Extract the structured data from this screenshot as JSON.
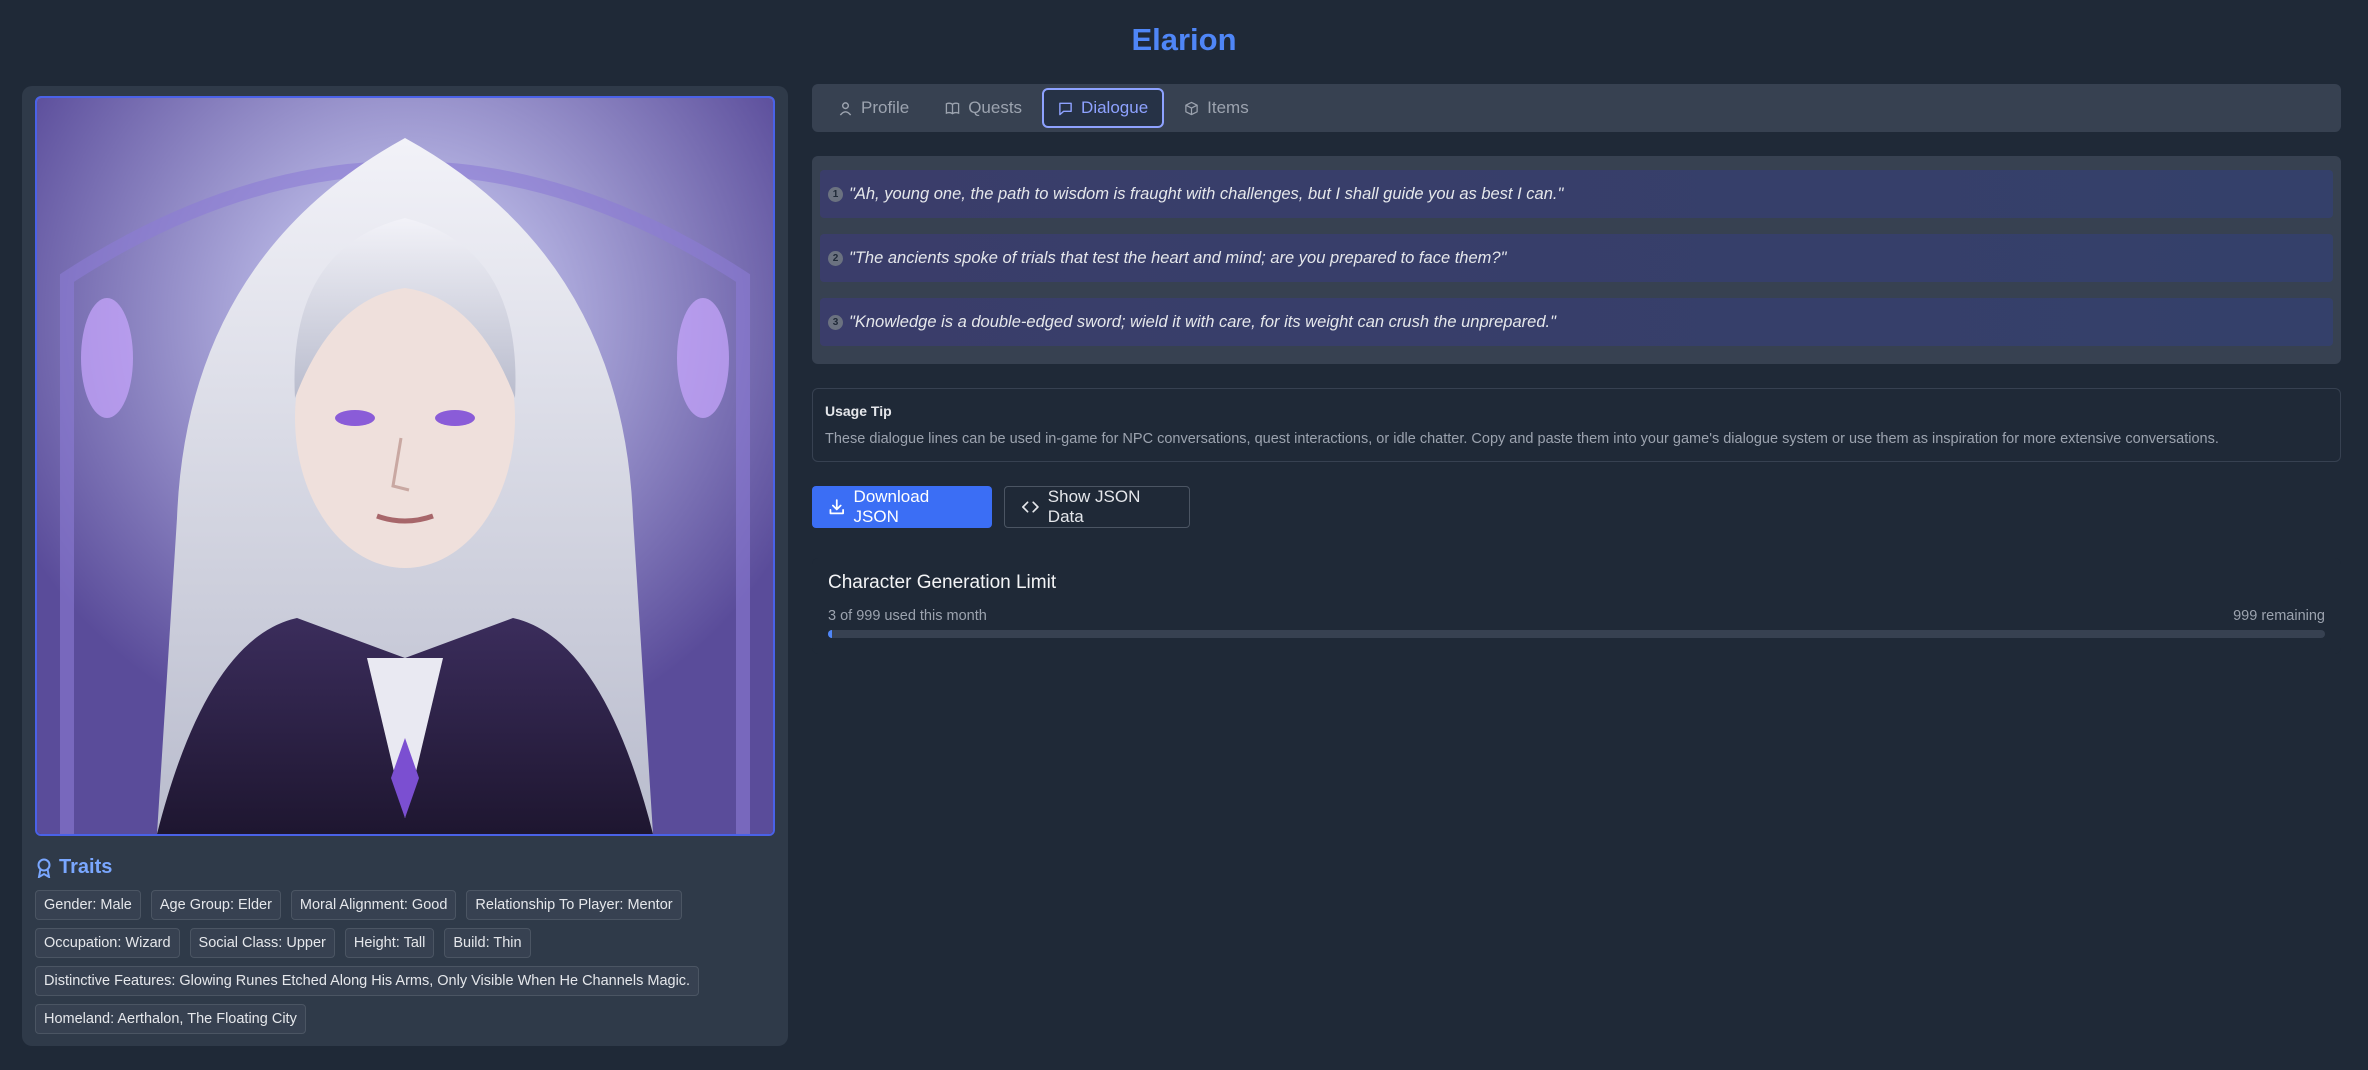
{
  "page": {
    "title": "Elarion"
  },
  "tabs": [
    {
      "label": "Profile",
      "icon": "user-icon"
    },
    {
      "label": "Quests",
      "icon": "book-icon"
    },
    {
      "label": "Dialogue",
      "icon": "message-icon",
      "active": true
    },
    {
      "label": "Items",
      "icon": "cube-icon"
    }
  ],
  "dialogue": [
    {
      "n": "1",
      "text": "\"Ah, young one, the path to wisdom is fraught with challenges, but I shall guide you as best I can.\""
    },
    {
      "n": "2",
      "text": "\"The ancients spoke of trials that test the heart and mind; are you prepared to face them?\""
    },
    {
      "n": "3",
      "text": "\"Knowledge is a double-edged sword; wield it with care, for its weight can crush the unprepared.\""
    }
  ],
  "tip": {
    "title": "Usage Tip",
    "text": "These dialogue lines can be used in-game for NPC conversations, quest interactions, or idle chatter. Copy and paste them into your game's dialogue system or use them as inspiration for more extensive conversations."
  },
  "buttons": {
    "download": "Download JSON",
    "show": "Show JSON Data"
  },
  "limit": {
    "title": "Character Generation Limit",
    "used_text": "3 of 999 used this month",
    "remaining_text": "999 remaining",
    "used_fraction": 0.003
  },
  "traits": {
    "heading": "Traits",
    "items": [
      "Gender: Male",
      "Age Group: Elder",
      "Moral Alignment: Good",
      "Relationship To Player: Mentor",
      "Occupation: Wizard",
      "Social Class: Upper",
      "Height: Tall",
      "Build: Thin",
      "Distinctive Features: Glowing Runes Etched Along His Arms, Only Visible When He Channels Magic.",
      "Homeland: Aerthalon, The Floating City"
    ]
  },
  "colors": {
    "accent": "#4f86f7",
    "active_tab": "#8ea2ff",
    "primary_button": "#3b6ef5"
  }
}
